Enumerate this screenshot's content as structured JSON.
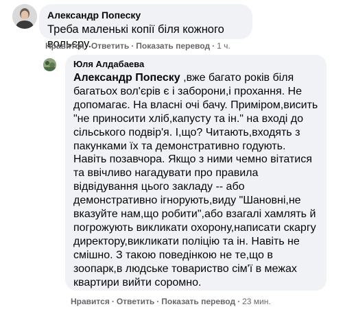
{
  "comment": {
    "author": "Александр Попеску",
    "text": "Треба маленькі копії біля кожного вольєру.",
    "actions": {
      "like": "Нравится",
      "reply": "Ответить",
      "show_translation": "Показать перевод",
      "time": "1 ч."
    }
  },
  "reply": {
    "author": "Юля Алдабаева",
    "mention": "Александр Попеску",
    "text": " ,вже багато років біля багатьох вол'єрів є і заборони,і прохання. Не допомагає. На власні очі бачу. Приміром,висить \"не приносити хліб,капусту та ін.\" на вході до сільського подвір'я. І,що? Читають,входять з пакунками їх та демонстративно годують. Навіть позавчора. Якщо з ними чемно вітатися та ввічливо нагадувати про правила відвідування цього закладу -- або демонстративно ігнорують,виду \"Шановні,не вказуйте нам,що робити\",або взагалі хамлять й погрожують викликати охорону,написати скаргу директору,викликати поліцію та ін. Навіть не смішно. З такою поведінкою не те,що в зоопарк,в людське товариство сім'ї в межах квартири вийти соромно.",
    "actions": {
      "like": "Нравится",
      "reply": "Ответить",
      "show_translation": "Показать перевод",
      "time": "23 мин."
    }
  }
}
